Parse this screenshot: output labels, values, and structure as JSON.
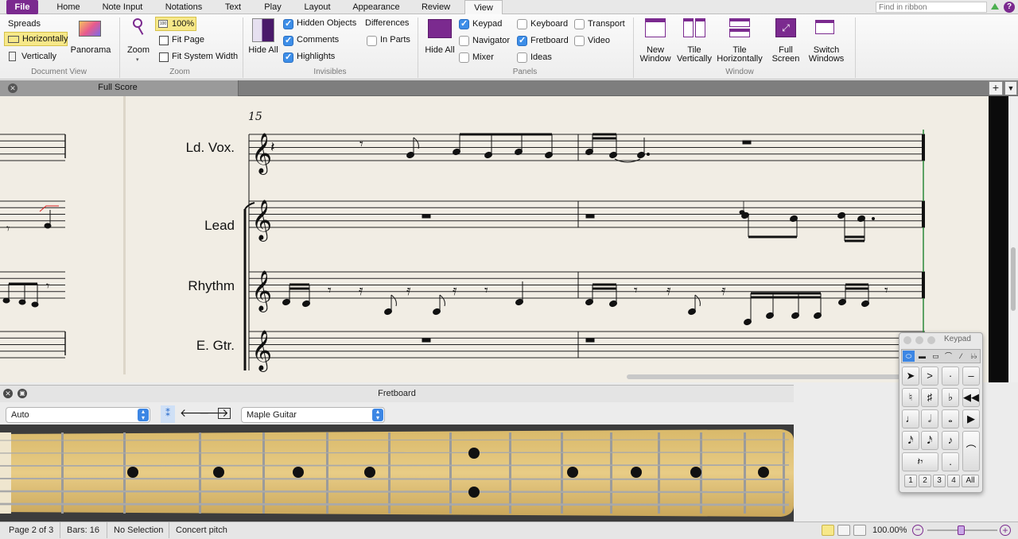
{
  "ribbon_tabs": [
    {
      "label": "File"
    },
    {
      "label": "Home"
    },
    {
      "label": "Note Input"
    },
    {
      "label": "Notations"
    },
    {
      "label": "Text"
    },
    {
      "label": "Play"
    },
    {
      "label": "Layout"
    },
    {
      "label": "Appearance"
    },
    {
      "label": "Review"
    },
    {
      "label": "View",
      "active": true
    }
  ],
  "search": {
    "placeholder": "Find in ribbon"
  },
  "document_view": {
    "spreads": "Spreads",
    "horizontally": "Horizontally",
    "vertically": "Vertically",
    "panorama": "Panorama",
    "group_label": "Document View"
  },
  "zoom": {
    "zoom_label": "Zoom",
    "percent": "100%",
    "fit_page": "Fit Page",
    "fit_system_width": "Fit System Width",
    "group_label": "Zoom"
  },
  "invisibles": {
    "hide_all": "Hide All",
    "hidden_objects": "Hidden Objects",
    "comments": "Comments",
    "highlights": "Highlights",
    "differences": "Differences",
    "in_parts": "In Parts",
    "group_label": "Invisibles",
    "hidden_objects_checked": true,
    "comments_checked": true,
    "highlights_checked": true,
    "in_parts_checked": false
  },
  "panels": {
    "hide_all": "Hide All",
    "keypad": "Keypad",
    "navigator": "Navigator",
    "mixer": "Mixer",
    "keyboard": "Keyboard",
    "fretboard": "Fretboard",
    "ideas": "Ideas",
    "transport": "Transport",
    "video": "Video",
    "group_label": "Panels"
  },
  "window": {
    "new_window": "New Window",
    "tile_vertically": "Tile Vertically",
    "tile_horizontally": "Tile Horizontally",
    "full_screen": "Full Screen",
    "switch_windows": "Switch Windows",
    "group_label": "Window"
  },
  "document_tab": {
    "label": "Full Score"
  },
  "score": {
    "bar_number": "15",
    "instruments": [
      "Ld. Vox.",
      "Lead",
      "Rhythm",
      "E. Gtr."
    ]
  },
  "fretboard_panel": {
    "title": "Fretboard",
    "mode": "Auto",
    "instrument": "Maple Guitar"
  },
  "keypad": {
    "title": "Keypad",
    "layouts": [
      "1",
      "2",
      "3",
      "4",
      "All"
    ]
  },
  "status": {
    "page": "Page 2 of 3",
    "bars": "Bars: 16",
    "selection": "No Selection",
    "pitch": "Concert pitch",
    "zoom": "100.00%"
  },
  "colors": {
    "accent": "#7b2a8f",
    "selected_yellow": "#f7e889",
    "checkbox_blue": "#3d8ee8"
  }
}
